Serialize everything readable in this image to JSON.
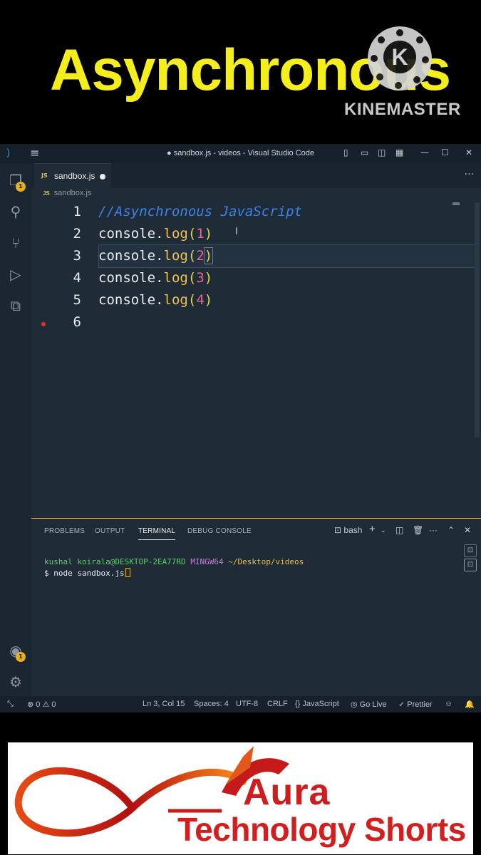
{
  "banner": {
    "title": "Asynchronous",
    "watermark_letter": "K",
    "watermark_text": "KINEMASTER",
    "title_color": "#f3ee1c"
  },
  "window": {
    "title": "● sandbox.js - videos - Visual Studio Code",
    "icons": [
      "vscode-icon",
      "menu-icon",
      "toggle-sidebar-icon",
      "toggle-panel-icon",
      "toggle-secondary-sidebar-icon",
      "customize-layout-icon",
      "minimize-icon",
      "maximize-icon",
      "close-icon"
    ],
    "controls": {
      "minimize": "—",
      "maximize": "☐",
      "close": "✕"
    }
  },
  "activity_bar": {
    "items": [
      {
        "icon": "explorer-icon",
        "badge": "1"
      },
      {
        "icon": "search-icon"
      },
      {
        "icon": "source-control-icon"
      },
      {
        "icon": "run-debug-icon"
      },
      {
        "icon": "extensions-icon"
      }
    ],
    "bottom": [
      {
        "icon": "accounts-icon",
        "badge": "1"
      },
      {
        "icon": "gear-icon"
      }
    ]
  },
  "editor": {
    "tab": {
      "lang": "JS",
      "name": "sandbox.js"
    },
    "breadcrumb": {
      "lang": "JS",
      "file": "sandbox.js"
    },
    "lines": [
      {
        "n": "1",
        "comment": "//Asynchronous JavaScript"
      },
      {
        "n": "2",
        "obj": "console",
        "dot": ".",
        "fn": "log",
        "open": "(",
        "arg": "1",
        "close": ")"
      },
      {
        "n": "3",
        "obj": "console",
        "dot": ".",
        "fn": "log",
        "open": "(",
        "arg": "2",
        "close": ")"
      },
      {
        "n": "4",
        "obj": "console",
        "dot": ".",
        "fn": "log",
        "open": "(",
        "arg": "3",
        "close": ")"
      },
      {
        "n": "5",
        "obj": "console",
        "dot": ".",
        "fn": "log",
        "open": "(",
        "arg": "4",
        "close": ")"
      },
      {
        "n": "6"
      }
    ]
  },
  "panel": {
    "tabs": [
      "PROBLEMS",
      "OUTPUT",
      "TERMINAL",
      "DEBUG CONSOLE"
    ],
    "active_tab": "TERMINAL",
    "shell": "bash",
    "terminal": {
      "user": "kushal koirala@DESKTOP-2EA77RD",
      "system": "MINGW64",
      "path": "~/Desktop/videos",
      "prompt": "$ node sandbox.js"
    }
  },
  "statusbar": {
    "errors": "0",
    "warnings": "0",
    "position": "Ln 3, Col 15",
    "spaces": "Spaces: 4",
    "encoding": "UTF-8",
    "eol": "CRLF",
    "language": "JavaScript",
    "golive": "Go Live",
    "prettier": "Prettier"
  },
  "brand": {
    "name": "Aura",
    "tagline": "Technology Shorts"
  }
}
